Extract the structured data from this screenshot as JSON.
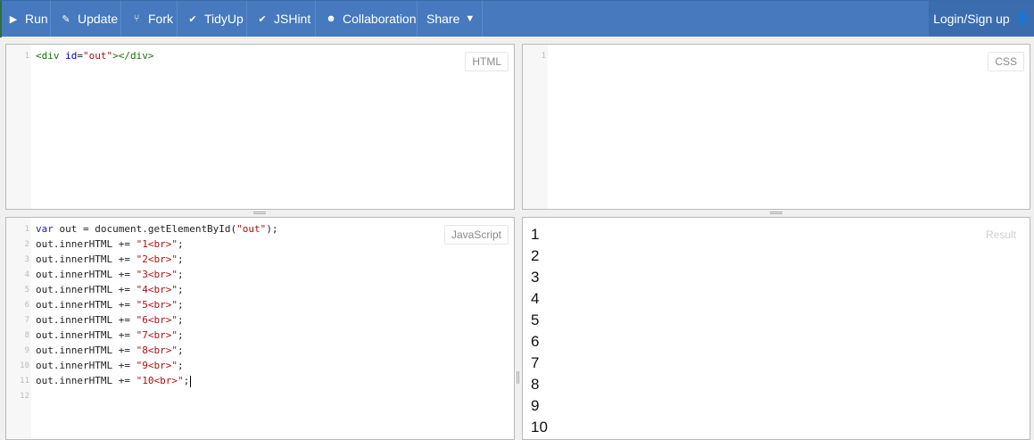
{
  "toolbar": {
    "run": "Run",
    "update": "Update",
    "fork": "Fork",
    "tidyup": "TidyUp",
    "jshint": "JSHint",
    "collaboration": "Collaboration",
    "share": "Share",
    "login": "Login/Sign up",
    "accent_color": "#4679bd"
  },
  "panels": {
    "html": {
      "label": "HTML",
      "line_numbers": [
        "1"
      ],
      "lines": [
        {
          "p1": "<div ",
          "p2": "id",
          "p3": "=",
          "p4": "\"out\"",
          "p5": "></div>"
        }
      ]
    },
    "css": {
      "label": "CSS",
      "line_numbers": [
        "1"
      ]
    },
    "javascript": {
      "label": "JavaScript",
      "line_numbers": [
        "1",
        "2",
        "3",
        "4",
        "5",
        "6",
        "7",
        "8",
        "9",
        "10",
        "11",
        "12"
      ],
      "line1": {
        "kw": "var",
        "rest": " out = document.getElementById(",
        "str": "\"out\"",
        "end": ");"
      },
      "lines": [
        {
          "pre": "out.innerHTML += ",
          "str": "\"1<br>\"",
          "end": ";"
        },
        {
          "pre": "out.innerHTML += ",
          "str": "\"2<br>\"",
          "end": ";"
        },
        {
          "pre": "out.innerHTML += ",
          "str": "\"3<br>\"",
          "end": ";"
        },
        {
          "pre": "out.innerHTML += ",
          "str": "\"4<br>\"",
          "end": ";"
        },
        {
          "pre": "out.innerHTML += ",
          "str": "\"5<br>\"",
          "end": ";"
        },
        {
          "pre": "out.innerHTML += ",
          "str": "\"6<br>\"",
          "end": ";"
        },
        {
          "pre": "out.innerHTML += ",
          "str": "\"7<br>\"",
          "end": ";"
        },
        {
          "pre": "out.innerHTML += ",
          "str": "\"8<br>\"",
          "end": ";"
        },
        {
          "pre": "out.innerHTML += ",
          "str": "\"9<br>\"",
          "end": ";"
        },
        {
          "pre": "out.innerHTML += ",
          "str": "\"10<br>\"",
          "end": ";"
        }
      ]
    },
    "result": {
      "label": "Result",
      "lines": [
        "1",
        "2",
        "3",
        "4",
        "5",
        "6",
        "7",
        "8",
        "9",
        "10"
      ]
    }
  }
}
